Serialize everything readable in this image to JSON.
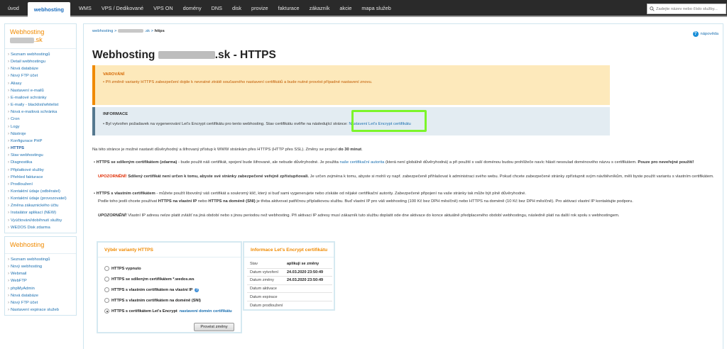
{
  "topnav": {
    "items": [
      "úvod",
      "webhosting",
      "WMS",
      "VPS / Dedikované",
      "VPS ON",
      "domény",
      "DNS",
      "disk",
      "provize",
      "fakturace",
      "zákazník",
      "akcie",
      "mapa služeb"
    ],
    "active_index": 1,
    "search_placeholder": "Zadejte název nebo číslo služby..."
  },
  "sidebar": {
    "box1": {
      "title_prefix": "Webhosting",
      "title_suffix": ".sk",
      "items": [
        "Seznam webhostingů",
        "Detail webhostingu",
        "Nová databáze",
        "Nový FTP účet",
        "Aliasy",
        "Nastavení e-mailů",
        "E-mailové schránky",
        "E-maily - blacklist/whitelist",
        "Nová e-mailová schránka",
        "Cron",
        "Logy",
        "Nástroje",
        "Konfigurace PHP",
        "HTTPS",
        "Stav webhostingu",
        "Diagnostika",
        "Připlatkové služby",
        "Přehled fakturace",
        "Prodloužení",
        "Kontaktní údaje (odběratel)",
        "Kontaktní údaje (provozovatel)",
        "Změna zákaznického účtu",
        "Instalátor aplikací (NEW)",
        "Vyúčtování/dobíhnutí služby",
        "WEDOS Disk zdarma"
      ],
      "active_index": 13
    },
    "box2": {
      "title": "Webhosting",
      "items": [
        "Seznam webhostingů",
        "Nový webhosting",
        "Webmail",
        "WebFTP",
        "phpMyAdmin",
        "Nová databáze",
        "Nový FTP účet",
        "Nastavení expirace služeb"
      ]
    }
  },
  "breadcrumb": {
    "first": "webhosting",
    "last": "https",
    "sep": ">"
  },
  "help_label": "nápověda",
  "page_title": {
    "prefix": "Webhosting ",
    "suffix": ".sk - HTTPS"
  },
  "warning": {
    "title": "VAROVÁNÍ",
    "text": "Při změně varianty HTTPS zabezpečení dojde k nevratné ztrátě současného nastavení certifikátů a bude nutné provést případné nastavení znovu."
  },
  "info": {
    "title": "INFORMACE",
    "text": "Byl vytvořen požadavek na vygenerování Let's Encrypt certifikátu pro tento webhosting. Stav certifikátu ověřte na následující stránce:",
    "link": "Nastavení Let's Encrypt certifikátu"
  },
  "intro": {
    "text": "Na této stránce je možné nastavit důvěryhodný a šifrovaný přístup k WWW stránkám přes HTTPS (HTTP přes SSL). Změny se projeví ",
    "bold": "do 30 minut",
    "end": "."
  },
  "shared": {
    "bold": "HTTPS se sdíleným certifikátem (zdarma)",
    "text1": " - bude použit náš certifikát, spojení bude šifrované, ale nebude důvěryhodné. Je použita ",
    "link": "naše certifikační autorita",
    "text2": " (která není globálně důvěryhodná) a při použití s vaší doménou budou prohlížeče navíc hlásit nesoulad doménového názvu s certifikátem. ",
    "bold2": "Pouze pro neveřejné použití!",
    "warn_label": "UPOZORNĚNÍ!",
    "warn_bold": " Sdílený certifikát není určen k tomu, abyste své stránky zabezpečené veřejně zpřístupňovali.",
    "warn_text": " Je určen zejména k tomu, abyste si mohli vy např. zabezpečeně přihlašovat k administraci svého webu. Pokud chcete zabezpečené stránky zpřístupnit svým návštěvníkům, měli byste použít variantu s vlastním certifikátem."
  },
  "own": {
    "bold": "HTTPS s vlastním certifikátem",
    "text": " - můžete použít libovolný váš certifikát a soukromý klíč, který si buď sami vygenerujete nebo získáte od nějaké certifikační autority. Zabezpečené připojení na vaše stránky tak může být plně důvěryhodné.",
    "line2a": "Podle toho jestli chcete používat ",
    "line2b": "HTTPS na vlastní IP",
    "line2c": " nebo ",
    "line2d": "HTTPS na doméně (SNI)",
    "line2e": " je třeba aktivovat patřičnou příplatkovou službu. Buď vlastní IP pro váš webhosting (100 Kč bez DPH měsíčně) nebo HTTPS na doméně (10 Kč bez DPH měsíčně). Pro aktivaci vlastní IP kontaktujte podporu."
  },
  "notice": {
    "label": "UPOZORNĚNÍ!",
    "text": " Vlastní IP adresu nelze platit zvlášť na jiná období nebo s jinou periodou než webhosting. Při aktivaci IP adresy musí zákazník tuto službu doplatit ode dne aktivace do konce aktuálně předplaceného období webhostingu, následně platí na další rok spolu s webhostingem."
  },
  "variant_panel": {
    "title": "Výběr varianty HTTPS",
    "options": [
      "HTTPS vypnuto",
      "HTTPS se sdíleným certifikátem *.wedos.ws",
      "HTTPS s vlastním certifikátem na vlastní IP",
      "HTTPS s vlastním certifikátem na doméně (SNI)",
      "HTTPS s certifikátem Let's Encrypt"
    ],
    "selected_index": 4,
    "le_link": "nastavení domén certifikátu",
    "button": "Provést změny"
  },
  "le_panel": {
    "title": "Informace Let's Encrypt certifikátu",
    "rows": [
      {
        "k": "Stav",
        "v": "aplikuji se změny"
      },
      {
        "k": "Datum vytvoření",
        "v": "24.03.2020 23:50:49"
      },
      {
        "k": "Datum změny",
        "v": "24.03.2020 23:50:49"
      },
      {
        "k": "Datum aktivace",
        "v": ""
      },
      {
        "k": "Datum expirace",
        "v": ""
      },
      {
        "k": "Datum prodloužení",
        "v": ""
      }
    ]
  }
}
